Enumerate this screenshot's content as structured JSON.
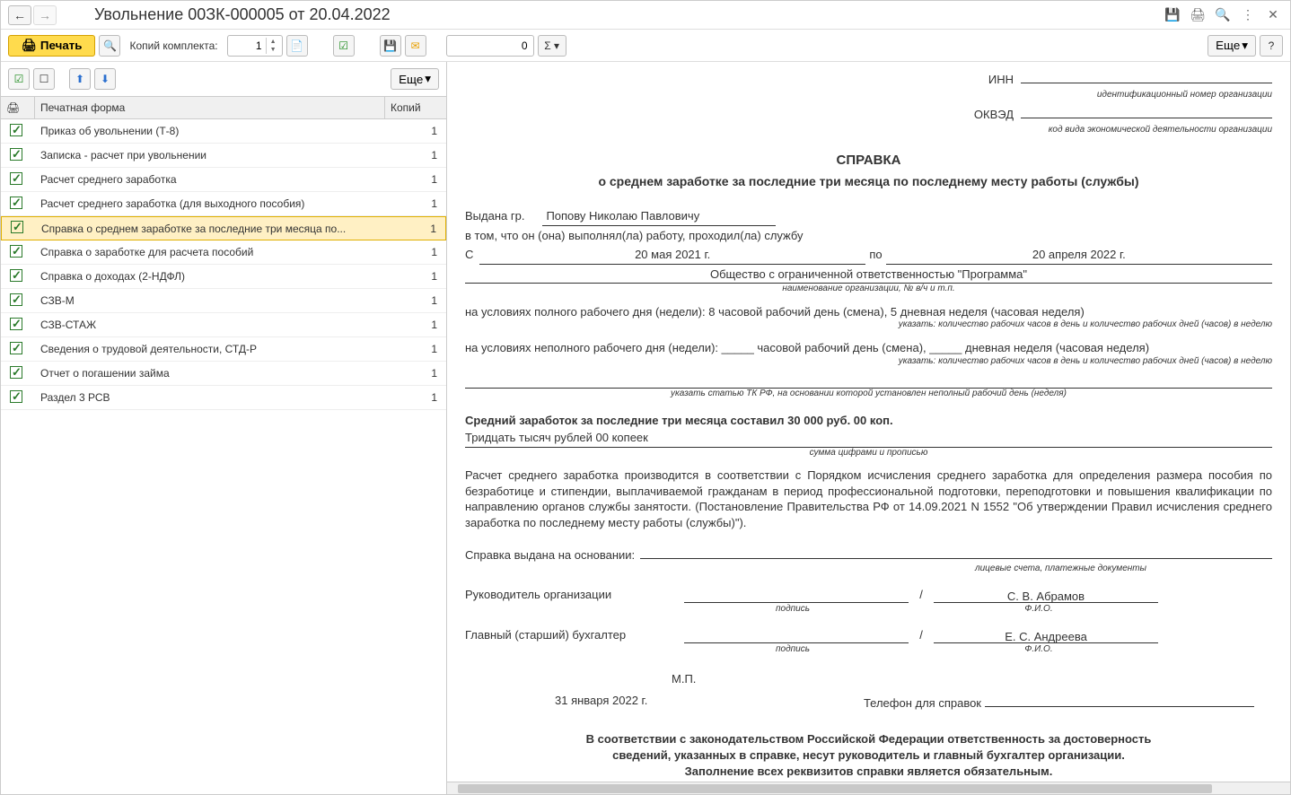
{
  "window": {
    "title": "Увольнение 00ЗК-000005 от 20.04.2022"
  },
  "toolbar": {
    "print_label": "Печать",
    "copies_label": "Копий комплекта:",
    "copies_value": "1",
    "zero_value": "0",
    "more_label": "Еще"
  },
  "left_toolbar": {
    "more_label": "Еще"
  },
  "forms": {
    "header_form": "Печатная форма",
    "header_copies": "Копий",
    "rows": [
      {
        "label": "Приказ об увольнении (Т-8)",
        "copies": "1"
      },
      {
        "label": "Записка - расчет при увольнении",
        "copies": "1"
      },
      {
        "label": "Расчет среднего заработка",
        "copies": "1"
      },
      {
        "label": "Расчет среднего заработка (для выходного пособия)",
        "copies": "1"
      },
      {
        "label": "Справка о среднем заработке за последние три месяца по...",
        "copies": "1"
      },
      {
        "label": "Справка о заработке для расчета пособий",
        "copies": "1"
      },
      {
        "label": "Справка о доходах (2-НДФЛ)",
        "copies": "1"
      },
      {
        "label": "СЗВ-М",
        "copies": "1"
      },
      {
        "label": "СЗВ-СТАЖ",
        "copies": "1"
      },
      {
        "label": "Сведения о трудовой деятельности, СТД-Р",
        "copies": "1"
      },
      {
        "label": "Отчет о погашении займа",
        "copies": "1"
      },
      {
        "label": "Раздел 3 РСВ",
        "copies": "1"
      }
    ],
    "selected_index": 4
  },
  "doc": {
    "inn_label": "ИНН",
    "inn_sub": "идентификационный номер организации",
    "okved_label": "ОКВЭД",
    "okved_sub": "код вида экономической деятельности организации",
    "title": "СПРАВКА",
    "subtitle": "о среднем заработке за последние три месяца по последнему месту работы (службы)",
    "issued_label": "Выдана гр.",
    "issued_name": "Попову Николаю Павловичу",
    "that_line": "в том, что он (она) выполнял(ла) работу, проходил(ла) службу",
    "from_label": "С",
    "date_from": "20 мая 2021 г.",
    "to_label": "по",
    "date_to": "20 апреля 2022 г.",
    "org_name": "Общество с ограниченной ответственностью \"Программа\"",
    "org_sub": "наименование организации, № в/ч и т.п.",
    "fulltime": "на условиях полного рабочего дня (недели): 8 часовой рабочий день (смена), 5 дневная неделя (часовая неделя)",
    "fulltime_sub": "указать: количество рабочих часов в день и количество рабочих дней (часов) в неделю",
    "parttime": "на условиях неполного рабочего дня (недели): _____ часовой рабочий день (смена), _____ дневная неделя (часовая неделя)",
    "parttime_sub": "указать: количество рабочих часов в день и количество рабочих дней (часов) в неделю",
    "tk_sub": "указать статью ТК РФ, на основании которой установлен неполный рабочий день (неделя)",
    "avg_line": "Средний заработок за последние три месяца составил 30 000 руб. 00 коп.",
    "avg_words": "Тридцать тысяч рублей 00 копеек",
    "avg_sub": "сумма цифрами и прописью",
    "calc_text": "Расчет среднего заработка производится в соответствии с Порядком исчисления среднего заработка для определения размера пособия по безработице и стипендии, выплачиваемой гражданам в период профессиональной подготовки, переподготовки и повышения квалификации по направлению органов службы занятости. (Постановление Правительства РФ от 14.09.2021 N 1552 \"Об утверждении Правил исчисления среднего заработка по последнему месту работы (службы)\").",
    "basis_label": "Справка выдана на основании:",
    "basis_sub": "лицевые счета, платежные документы",
    "role_head": "Руководитель организации",
    "role_acc": "Главный (старший) бухгалтер",
    "sign_sub": "подпись",
    "fio_sub": "Ф.И.О.",
    "fio_head": "С. В. Абрамов",
    "fio_acc": "Е. С. Андреева",
    "mp_label": "М.П.",
    "date_text": "31 января 2022 г.",
    "phone_label": "Телефон для справок",
    "footer1": "В соответствии с законодательством Российской Федерации ответственность за достоверность",
    "footer2": "сведений, указанных в справке, несут руководитель и главный бухгалтер организации.",
    "footer3": "Заполнение всех реквизитов справки является обязательным."
  }
}
